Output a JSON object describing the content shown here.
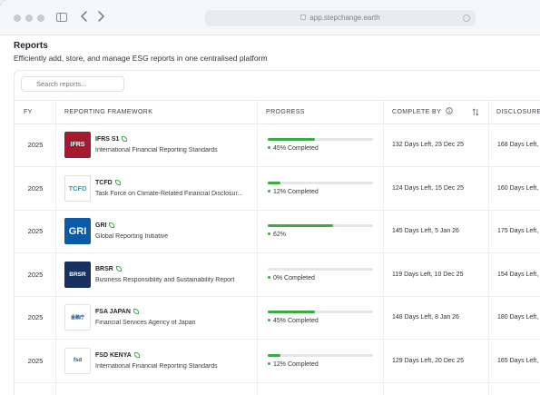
{
  "browser": {
    "url": "app.stepchange.earth"
  },
  "page": {
    "title": "Reports",
    "subtitle": "Efficiently add, store, and manage ESG reports in one centralised platform"
  },
  "search": {
    "placeholder": "Search reports..."
  },
  "table": {
    "headers": {
      "fy": "FY",
      "framework": "REPORTING FRAMEWORK",
      "progress": "PROGRESS",
      "complete_by": "COMPLETE BY",
      "disclosure": "DISCLOSURE"
    },
    "rows": [
      {
        "fy": "2025",
        "logo": "IFRS",
        "code": "IFRS S1",
        "name": "International Financial Reporting Standards",
        "progress": 0.45,
        "progress_label": "45% Completed",
        "complete_by": "132 Days Left, 23 Dec 25",
        "disclosure": "168 Days Left,"
      },
      {
        "fy": "2025",
        "logo": "TCFD",
        "code": "TCFD",
        "name": "Task Force on Climate-Related Financial Disclosur...",
        "progress": 0.12,
        "progress_label": "12% Completed",
        "complete_by": "124 Days Left, 15 Dec 25",
        "disclosure": "160 Days Left,"
      },
      {
        "fy": "2025",
        "logo": "GRI",
        "code": "GRI",
        "name": "Global Reporting Initiative",
        "progress": 0.62,
        "progress_label": "62%",
        "complete_by": "145 Days Left, 5 Jan 26",
        "disclosure": "175 Days Left,"
      },
      {
        "fy": "2025",
        "logo": "BRSR",
        "code": "BRSR",
        "name": "Business Responsibility and Sustainability Report",
        "progress": 0.0,
        "progress_label": "0% Completed",
        "complete_by": "119 Days Left, 10 Dec 25",
        "disclosure": "154 Days Left,"
      },
      {
        "fy": "2025",
        "logo": "金融庁",
        "code": "FSA JAPAN",
        "name": "Financial Services Agency of Japan",
        "progress": 0.45,
        "progress_label": "45% Completed",
        "complete_by": "148 Days Left, 8 Jan 26",
        "disclosure": "180 Days Left,"
      },
      {
        "fy": "2025",
        "logo": "fsd",
        "code": "FSD KENYA",
        "name": "International Financial Reporting Standards",
        "progress": 0.12,
        "progress_label": "12% Completed",
        "complete_by": "129 Days Left, 20 Dec 25",
        "disclosure": "165 Days Left,"
      }
    ]
  }
}
